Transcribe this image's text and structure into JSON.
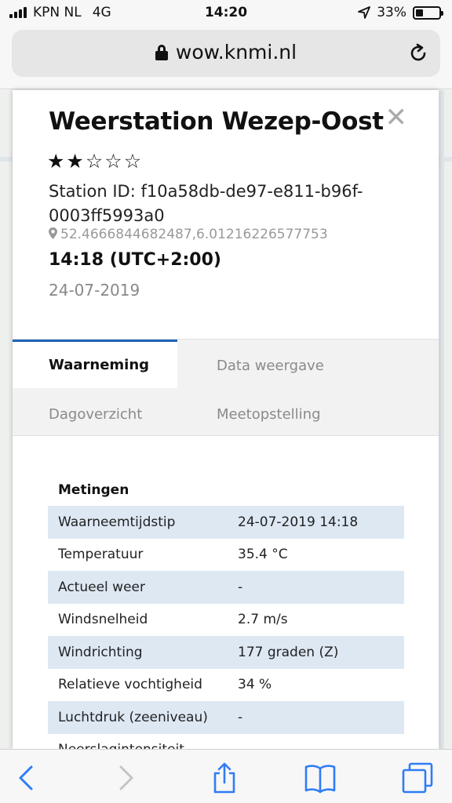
{
  "status_bar": {
    "carrier": "KPN NL",
    "network": "4G",
    "time": "14:20",
    "battery": "33%",
    "battery_level": 0.33
  },
  "browser": {
    "url": "wow.knmi.nl"
  },
  "station": {
    "title": "Weerstation Wezep-Oost",
    "rating": 2,
    "rating_max": 5,
    "station_id": "Station ID: f10a58db-de97-e811-b96f-0003ff5993a0",
    "coordinates": "52.4666844682487,6.01216226577753",
    "time": "14:18 (UTC+2:00)",
    "date": "24-07-2019"
  },
  "tabs": {
    "waarneming": "Waarneming",
    "data_weergave": "Data weergave",
    "dagoverzicht": "Dagoverzicht",
    "meetopstelling": "Meetopstelling"
  },
  "metingen": {
    "title": "Metingen",
    "rows": [
      {
        "label": "Waarneemtijdstip",
        "value": "24-07-2019 14:18"
      },
      {
        "label": "Temperatuur",
        "value": "35.4 °C"
      },
      {
        "label": "Actueel weer",
        "value": "-"
      },
      {
        "label": "Windsnelheid",
        "value": "2.7 m/s"
      },
      {
        "label": "Windrichting",
        "value": "177 graden (Z)"
      },
      {
        "label": "Relatieve vochtigheid",
        "value": "34 %"
      },
      {
        "label": "Luchtdruk (zeeniveau)",
        "value": "-"
      },
      {
        "label": "Neerslagintensiteit",
        "value": ""
      }
    ]
  },
  "colors": {
    "accent": "#1f63b4",
    "ios_blue": "#2f7cf6",
    "row_stripe": "#dde8f3"
  },
  "icons": {
    "back": "chevron-left-icon",
    "forward": "chevron-right-icon",
    "share": "share-icon",
    "bookmarks": "book-icon",
    "tabs": "tabs-icon",
    "reload": "reload-icon",
    "close": "close-icon",
    "pin": "map-pin-icon",
    "lock": "lock-icon"
  }
}
